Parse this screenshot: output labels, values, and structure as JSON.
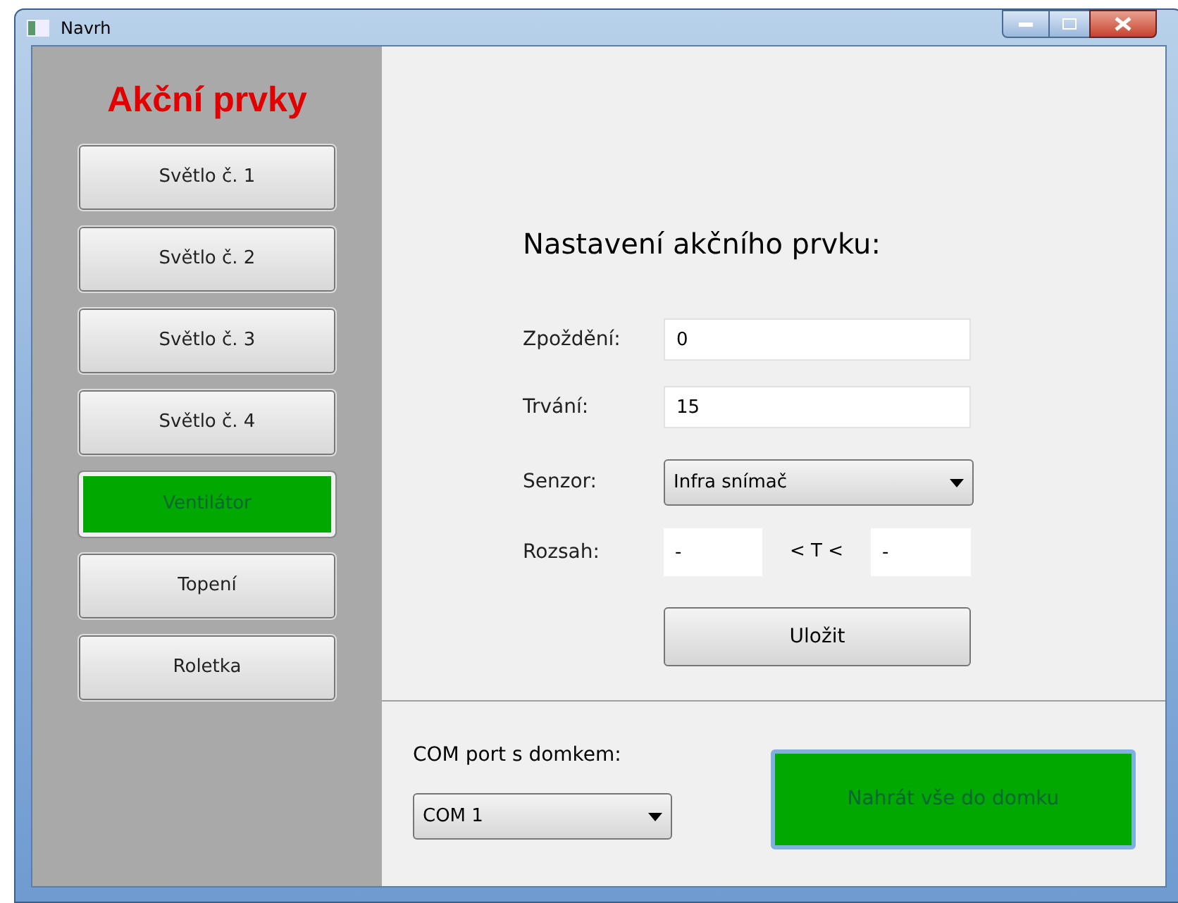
{
  "window": {
    "title": "Navrh"
  },
  "sidebar": {
    "title": "Akční prvky",
    "items": [
      {
        "label": "Světlo č. 1",
        "selected": false
      },
      {
        "label": "Světlo č. 2",
        "selected": false
      },
      {
        "label": "Světlo č. 3",
        "selected": false
      },
      {
        "label": "Světlo č. 4",
        "selected": false
      },
      {
        "label": "Ventilátor",
        "selected": true
      },
      {
        "label": "Topení",
        "selected": false
      },
      {
        "label": "Roletka",
        "selected": false
      }
    ]
  },
  "settings": {
    "heading": "Nastavení akčního prvku:",
    "delay": {
      "label": "Zpoždění:",
      "value": "0"
    },
    "duration": {
      "label": "Trvání:",
      "value": "15"
    },
    "sensor": {
      "label": "Senzor:",
      "value": "Infra snímač"
    },
    "range": {
      "label": "Rozsah:",
      "min": "-",
      "separator": "< T <",
      "max": "-"
    },
    "save_button": "Uložit"
  },
  "com": {
    "label": "COM port s domkem:",
    "value": "COM 1"
  },
  "upload_button": "Nahrát vše do domku"
}
